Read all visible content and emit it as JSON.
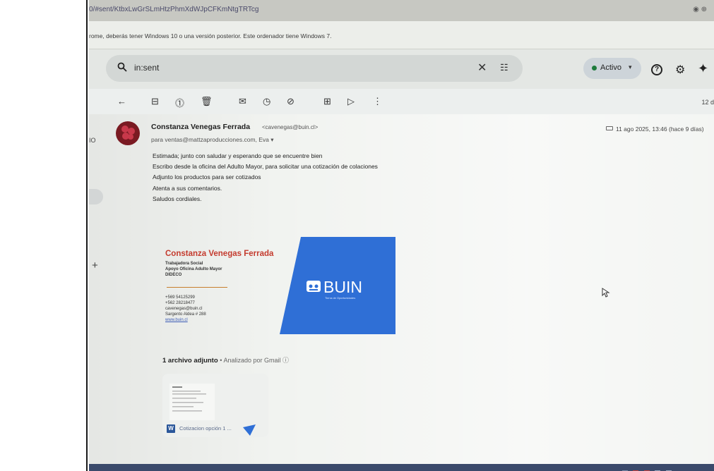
{
  "browser": {
    "url": "0/#sent/KtbxLwGrSLmHtzPhmXdWJpCFKmNtgTRTcg",
    "warning": "rome, deberás tener Windows 10 o una versión posterior. Este ordenador tiene Windows 7."
  },
  "header": {
    "search_value": "in:sent",
    "status_label": "Activo"
  },
  "toolbar": {
    "date_short": "12 d"
  },
  "sidebar": {
    "snippet": "IO"
  },
  "message": {
    "sender_name": "Constanza Venegas Ferrada",
    "sender_email": "<cavenegas@buin.cl>",
    "recipients": "para ventas@mattzaproducciones.com, Eva ▾",
    "timestamp": "11 ago 2025, 13:46 (hace 9 días)",
    "body": [
      "Estimada; junto con saludar y esperando que se encuentre bien",
      "Escribo desde la oficina del Adulto Mayor, para solicitar una cotización de colaciones",
      "Adjunto los productos para ser cotizados",
      "Atenta a sus comentarios.",
      "Saludos cordiales."
    ]
  },
  "signature": {
    "name": "Constanza Venegas Ferrada",
    "role_lines": [
      "Trabajadora Social",
      "Apoyo Oficina Adulto Mayor",
      "DIDECO"
    ],
    "contact_lines": [
      "+569 54125299",
      "+562 28218477",
      "cavenegas@buin.cl",
      "Sargento Aldea # 288",
      "www.buin.cl"
    ],
    "logo_text": "BUIN",
    "logo_tagline": "Tierra de Oportunidades"
  },
  "attachments": {
    "heading": "1 archivo adjunto",
    "scanned": "• Analizado por Gmail ⓘ",
    "file_name": "Cotizacion opción 1 ..."
  },
  "colors": {
    "sender_red": "#c43b2e",
    "buin_blue": "#2f6fd6",
    "word_blue": "#2b579a",
    "status_green": "#1e7b3c"
  }
}
